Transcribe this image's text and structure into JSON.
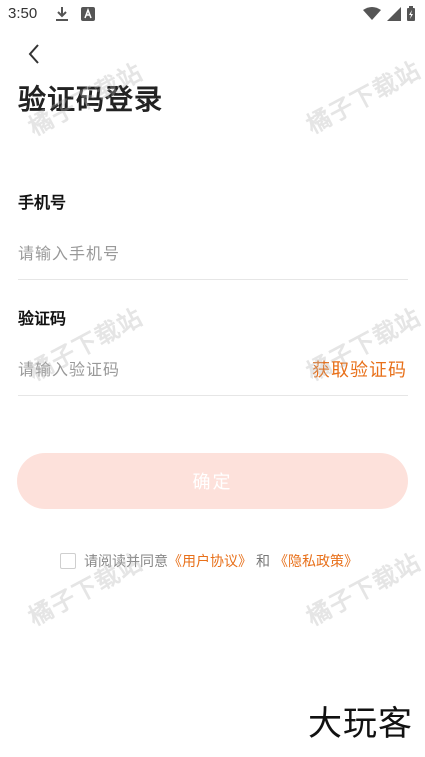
{
  "status_bar": {
    "time": "3:50"
  },
  "page": {
    "title": "验证码登录"
  },
  "phone": {
    "label": "手机号",
    "placeholder": "请输入手机号"
  },
  "code": {
    "label": "验证码",
    "placeholder": "请输入验证码",
    "get_code_label": "获取验证码"
  },
  "confirm": {
    "label": "确定"
  },
  "agreement": {
    "prefix": "请阅读并同意",
    "user_agreement": "《用户协议》",
    "and": "和",
    "privacy_policy": "《隐私政策》"
  },
  "watermark": {
    "text": "橘子下载站"
  },
  "brand": {
    "text": "大玩客"
  },
  "colors": {
    "accent": "#e8701a",
    "button_bg": "#fde1db"
  }
}
